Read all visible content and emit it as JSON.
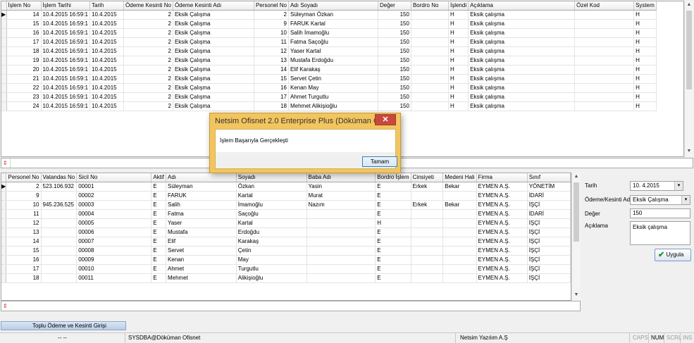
{
  "top_grid": {
    "columns": [
      "İşlem No",
      "İşlem Tarihi",
      "Tarih",
      "Ödeme Kesinti No",
      "Ödeme Kesinti Adı",
      "Personel No",
      "Adı Soyadı",
      "Değer",
      "Bordro No",
      "İşlendi",
      "Açıklama",
      "Özel Kod",
      "System"
    ],
    "rows": [
      [
        "14",
        "10.4.2015 16:59:1",
        "10.4.2015",
        "2",
        "Eksik Çalışma",
        "2",
        "Süleyman Özkan",
        "150",
        "",
        "H",
        "Eksik çalışma",
        "",
        "H"
      ],
      [
        "15",
        "10.4.2015 16:59:1",
        "10.4.2015",
        "2",
        "Eksik Çalışma",
        "9",
        "FARUK Kartal",
        "150",
        "",
        "H",
        "Eksik çalışma",
        "",
        "H"
      ],
      [
        "16",
        "10.4.2015 16:59:1",
        "10.4.2015",
        "2",
        "Eksik Çalışma",
        "10",
        "Salih  İmamoğlu",
        "150",
        "",
        "H",
        "Eksik çalışma",
        "",
        "H"
      ],
      [
        "17",
        "10.4.2015 16:59:1",
        "10.4.2015",
        "2",
        "Eksik Çalışma",
        "11",
        "Fatma Saçoğlu",
        "150",
        "",
        "H",
        "Eksik çalışma",
        "",
        "H"
      ],
      [
        "18",
        "10.4.2015 16:59:1",
        "10.4.2015",
        "2",
        "Eksik Çalışma",
        "12",
        "Yaser  Kartal",
        "150",
        "",
        "H",
        "Eksik çalışma",
        "",
        "H"
      ],
      [
        "19",
        "10.4.2015 16:59:1",
        "10.4.2015",
        "2",
        "Eksik Çalışma",
        "13",
        "Mustafa Erdoğdu",
        "150",
        "",
        "H",
        "Eksik çalışma",
        "",
        "H"
      ],
      [
        "20",
        "10.4.2015 16:59:1",
        "10.4.2015",
        "2",
        "Eksik Çalışma",
        "14",
        "Elif Karakaş",
        "150",
        "",
        "H",
        "Eksik çalışma",
        "",
        "H"
      ],
      [
        "21",
        "10.4.2015 16:59:1",
        "10.4.2015",
        "2",
        "Eksik Çalışma",
        "15",
        "Servet  Çetin",
        "150",
        "",
        "H",
        "Eksik çalışma",
        "",
        "H"
      ],
      [
        "22",
        "10.4.2015 16:59:1",
        "10.4.2015",
        "2",
        "Eksik Çalışma",
        "16",
        "Kenan May",
        "150",
        "",
        "H",
        "Eksik çalışma",
        "",
        "H"
      ],
      [
        "23",
        "10.4.2015 16:59:1",
        "10.4.2015",
        "2",
        "Eksik Çalışma",
        "17",
        "Ahmet Turgutlu",
        "150",
        "",
        "H",
        "Eksik çalışma",
        "",
        "H"
      ],
      [
        "24",
        "10.4.2015 16:59:1",
        "10.4.2015",
        "2",
        "Eksik Çalışma",
        "18",
        "Mehmet Alikişioğlu",
        "150",
        "",
        "H",
        "Eksik çalışma",
        "",
        "H"
      ]
    ]
  },
  "bottom_grid": {
    "columns": [
      "Personel No",
      "Vatandas No",
      "Sicil No",
      "Aktif",
      "Adı",
      "Soyadı",
      "Baba Adı",
      "Bordro İşlem",
      "Cinsiyeti",
      "Medeni Hali",
      "Firma",
      "Sınıf"
    ],
    "rows": [
      [
        "2",
        "523.106.932",
        "00001",
        "E",
        "Süleyman",
        "Özkan",
        "Yasin",
        "E",
        "Erkek",
        "Bekar",
        "EYMEN A.Ş.",
        "YÖNETİM"
      ],
      [
        "9",
        "",
        "00002",
        "E",
        "FARUK",
        "Kartal",
        "Murat",
        "E",
        "",
        "",
        "EYMEN A.Ş.",
        "İDARİ"
      ],
      [
        "10",
        "945.236.525",
        "00003",
        "E",
        "Salih",
        "İmamoğlu",
        "Nazım",
        "E",
        "Erkek",
        "Bekar",
        "EYMEN A.Ş.",
        "İŞÇİ"
      ],
      [
        "11",
        "",
        "00004",
        "E",
        "Fatma",
        "Saçoğlu",
        "",
        "E",
        "",
        "",
        "EYMEN A.Ş.",
        "İDARİ"
      ],
      [
        "12",
        "",
        "00005",
        "E",
        "Yaser",
        "Kartal",
        "",
        "H",
        "",
        "",
        "EYMEN A.Ş.",
        "İŞÇİ"
      ],
      [
        "13",
        "",
        "00006",
        "E",
        "Mustafa",
        "Erdoğdu",
        "",
        "E",
        "",
        "",
        "EYMEN A.Ş.",
        "İŞÇİ"
      ],
      [
        "14",
        "",
        "00007",
        "E",
        "Elif",
        "Karakaş",
        "",
        "E",
        "",
        "",
        "EYMEN A.Ş.",
        "İŞÇİ"
      ],
      [
        "15",
        "",
        "00008",
        "E",
        "Servet",
        "Çetin",
        "",
        "E",
        "",
        "",
        "EYMEN A.Ş.",
        "İŞÇİ"
      ],
      [
        "16",
        "",
        "00009",
        "E",
        "Kenan",
        "May",
        "",
        "E",
        "",
        "",
        "EYMEN A.Ş.",
        "İŞÇİ"
      ],
      [
        "17",
        "",
        "00010",
        "E",
        "Ahmet",
        "Turgutlu",
        "",
        "E",
        "",
        "",
        "EYMEN A.Ş.",
        "İŞÇİ"
      ],
      [
        "18",
        "",
        "00011",
        "E",
        "Mehmet",
        "Alikişioğlu",
        "",
        "E",
        "",
        "",
        "EYMEN A.Ş.",
        "İŞÇİ"
      ]
    ]
  },
  "panel": {
    "tarih_label": "Tarih",
    "tarih_value": "10.  4.2015",
    "odeme_label": "Ödeme/Kesinti Adı",
    "odeme_value": "Eksik Çalışma",
    "deger_label": "Değer",
    "deger_value": "150",
    "aciklama_label": "Açıklama",
    "aciklama_value": "Eksik çalışma",
    "apply_label": "Uygula"
  },
  "tab": {
    "label": "Toplu Ödeme ve Kesinti Girişi"
  },
  "status": {
    "dashes": "-- --",
    "user": "SYSDBA@Döküman Ofisnet",
    "company": "Netsim Yazılım A.Ş",
    "caps": "CAPS",
    "num": "NUM",
    "scrl": "SCRL",
    "ins": "INS"
  },
  "dialog": {
    "title": "Netsim Ofisnet 2.0 Enterprise Plus (Döküman Of...",
    "close": "✕",
    "message": "İşlem Başarıyla Gerçekleşti",
    "ok_label": "Tamam"
  }
}
